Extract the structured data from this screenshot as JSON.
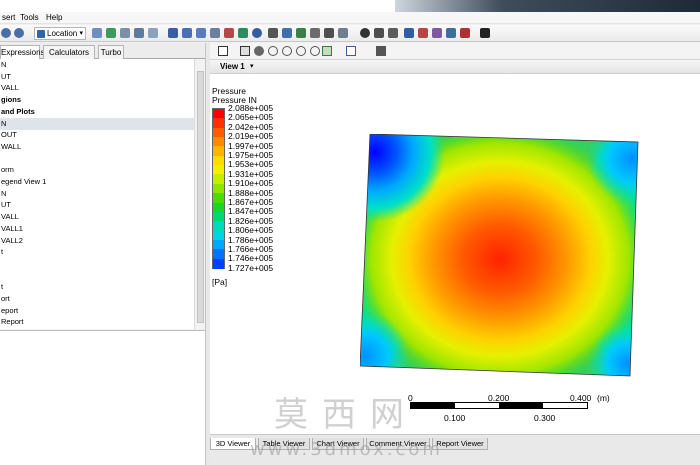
{
  "menu": {
    "items": [
      "sert",
      "Tools",
      "Help"
    ]
  },
  "toolbar": {
    "location_label": "Location"
  },
  "left_tabs": [
    "Expressions",
    "Calculators",
    "Turbo"
  ],
  "tree": [
    {
      "label": "N",
      "bold": false
    },
    {
      "label": "UT",
      "bold": false
    },
    {
      "label": "VALL",
      "bold": false
    },
    {
      "label": "gions",
      "bold": true
    },
    {
      "label": "and Plots",
      "bold": true
    },
    {
      "label": "N",
      "bold": false,
      "selected": true
    },
    {
      "label": "OUT",
      "bold": false
    },
    {
      "label": "WALL",
      "bold": false
    },
    {
      "label": "",
      "bold": false
    },
    {
      "label": "orm",
      "bold": false
    },
    {
      "label": "egend View 1",
      "bold": false
    },
    {
      "label": "N",
      "bold": false
    },
    {
      "label": "UT",
      "bold": false
    },
    {
      "label": "VALL",
      "bold": false
    },
    {
      "label": "VALL1",
      "bold": false
    },
    {
      "label": "VALL2",
      "bold": false
    },
    {
      "label": "t",
      "bold": false
    },
    {
      "label": "",
      "bold": false
    },
    {
      "label": "",
      "bold": false
    },
    {
      "label": "t",
      "bold": false
    },
    {
      "label": "ort",
      "bold": false
    },
    {
      "label": "eport",
      "bold": false
    },
    {
      "label": "Report",
      "bold": false
    }
  ],
  "viewer": {
    "view_label": "View 1"
  },
  "legend": {
    "title": "Pressure",
    "variable": "Pressure IN",
    "unit": "[Pa]",
    "values": [
      "2.088e+005",
      "2.065e+005",
      "2.042e+005",
      "2.019e+005",
      "1.997e+005",
      "1.975e+005",
      "1.953e+005",
      "1.931e+005",
      "1.910e+005",
      "1.888e+005",
      "1.867e+005",
      "1.847e+005",
      "1.826e+005",
      "1.806e+005",
      "1.786e+005",
      "1.766e+005",
      "1.746e+005",
      "1.727e+005"
    ]
  },
  "scale": {
    "labels_top": [
      "0",
      "0.200",
      "0.400"
    ],
    "labels_bottom": [
      "0.100",
      "0.300"
    ],
    "unit": "(m)"
  },
  "bottom_tabs": [
    "3D Viewer",
    "Table Viewer",
    "Chart Viewer",
    "Comment Viewer",
    "Report Viewer"
  ],
  "watermark": {
    "line1": "莫西网",
    "line2": "www.3dmox.com"
  }
}
